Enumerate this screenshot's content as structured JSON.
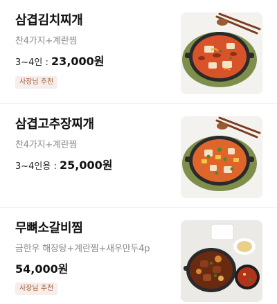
{
  "menu": [
    {
      "name": "삼겹김치찌개",
      "desc": "찬4가지+계란찜",
      "price_prefix": "3~4인 : ",
      "price": "23,000원",
      "badge": "사장님 추천",
      "image": "kimchi-stew-image"
    },
    {
      "name": "삼겹고추장찌개",
      "desc": "찬4가지+계란찜",
      "price_prefix": "3~4인용 : ",
      "price": "25,000원",
      "image": "gochujang-stew-image"
    },
    {
      "name": "무뼈소갈비찜",
      "desc": "금한우 해장탕+계란찜+새우만두4p",
      "price": "54,000원",
      "badge": "사장님 추천",
      "image": "braised-short-rib-image"
    }
  ],
  "colors": {
    "badge_bg": "#f5eeea",
    "badge_text": "#a45a38",
    "stew_red": "#d9532a"
  }
}
